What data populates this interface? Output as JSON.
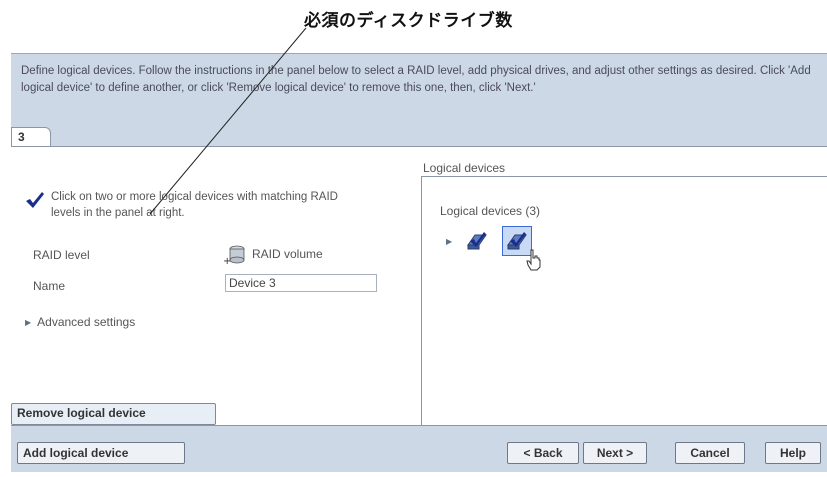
{
  "callout": {
    "text": "必須のディスクドライブ数"
  },
  "instructions": {
    "text": "Define logical devices. Follow the instructions in the panel below to select a RAID level, add physical drives, and adjust other settings as desired. Click 'Add logical device' to define another, or click 'Remove logical device' to remove this one, then, click 'Next.'"
  },
  "tab": {
    "label": "3"
  },
  "tip": {
    "text": "Click on two or more logical devices with matching RAID levels in the panel at right."
  },
  "raid": {
    "label": "RAID level",
    "value": "RAID volume"
  },
  "name": {
    "label": "Name",
    "value": "Device 3"
  },
  "advanced": {
    "label": "Advanced settings"
  },
  "remove_button": "Remove logical device",
  "logical_devices": {
    "title": "Logical devices",
    "header": "Logical devices (3)"
  },
  "buttons": {
    "add": "Add logical device",
    "back": "< Back",
    "next": "Next >",
    "cancel": "Cancel",
    "help": "Help"
  },
  "colors": {
    "panel_bg": "#ccd8e6",
    "accent": "#3b6bd8",
    "check": "#1b2e8c"
  }
}
